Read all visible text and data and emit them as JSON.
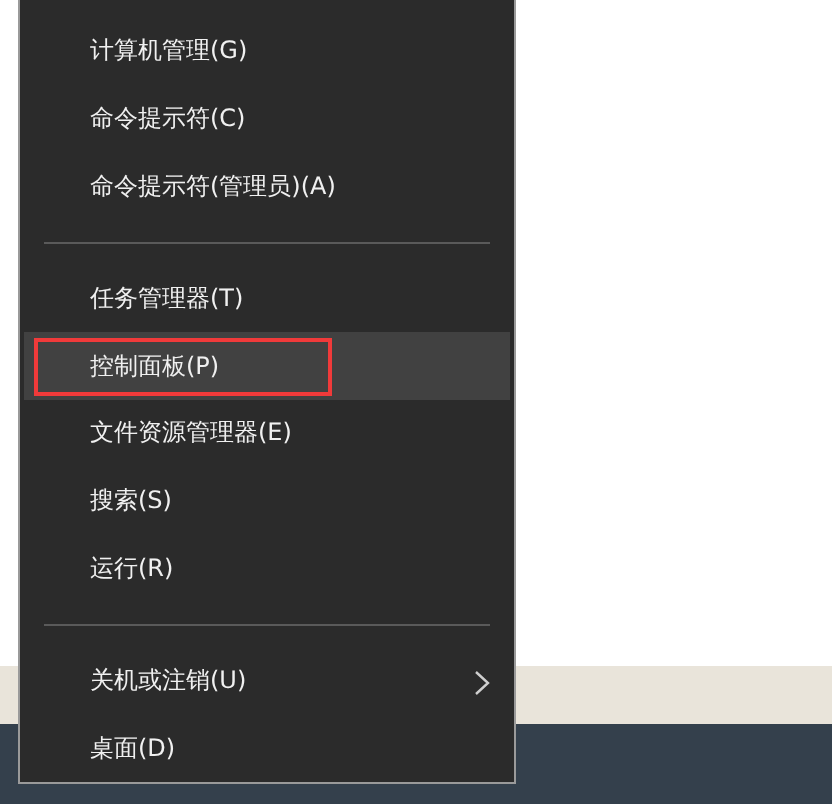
{
  "menu": {
    "items": [
      {
        "kind": "item",
        "label": "计算机管理(G)",
        "selected": false,
        "outlined": false,
        "submenu": false
      },
      {
        "kind": "item",
        "label": "命令提示符(C)",
        "selected": false,
        "outlined": false,
        "submenu": false
      },
      {
        "kind": "item",
        "label": "命令提示符(管理员)(A)",
        "selected": false,
        "outlined": false,
        "submenu": false
      },
      {
        "kind": "separator"
      },
      {
        "kind": "item",
        "label": "任务管理器(T)",
        "selected": false,
        "outlined": false,
        "submenu": false
      },
      {
        "kind": "item",
        "label": "控制面板(P)",
        "selected": true,
        "outlined": true,
        "submenu": false
      },
      {
        "kind": "item",
        "label": "文件资源管理器(E)",
        "selected": false,
        "outlined": false,
        "submenu": false
      },
      {
        "kind": "item",
        "label": "搜索(S)",
        "selected": false,
        "outlined": false,
        "submenu": false
      },
      {
        "kind": "item",
        "label": "运行(R)",
        "selected": false,
        "outlined": false,
        "submenu": false
      },
      {
        "kind": "separator"
      },
      {
        "kind": "item",
        "label": "关机或注销(U)",
        "selected": false,
        "outlined": false,
        "submenu": true
      },
      {
        "kind": "item",
        "label": "桌面(D)",
        "selected": false,
        "outlined": false,
        "submenu": false
      }
    ]
  }
}
